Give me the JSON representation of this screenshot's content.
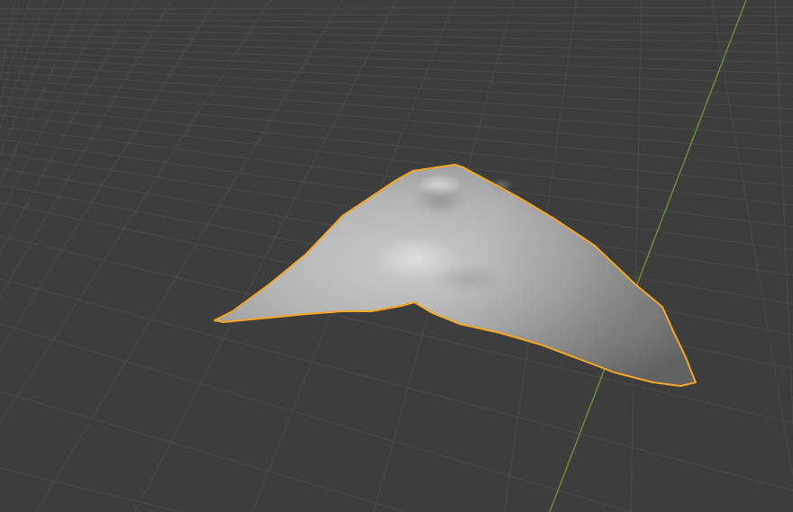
{
  "viewport": {
    "background_color": "#3d3d3d",
    "grid_line_color": "#4a4a4a",
    "y_axis_color": "#6b8a2e",
    "selection_outline_color": "#f5a623",
    "mesh_base_color": "#a8a8a8",
    "mesh_highlight_color": "#cfcfcf",
    "mesh_shadow_color": "#7e7e7e",
    "selected_object": "sculpted-mesh",
    "selected": true
  }
}
